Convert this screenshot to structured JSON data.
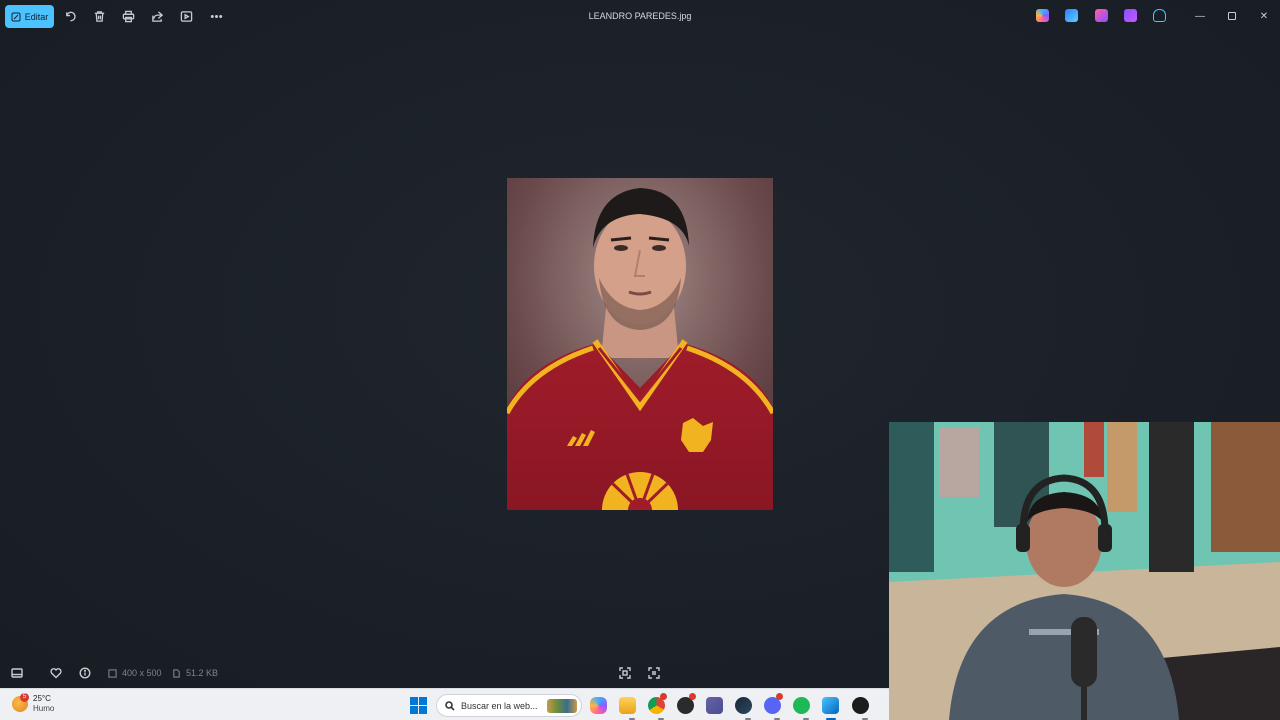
{
  "toolbar": {
    "edit_label": "Editar",
    "title": "LEANDRO PAREDES.jpg",
    "icons": [
      "rotate-icon",
      "delete-icon",
      "print-icon",
      "share-icon",
      "slideshow-icon",
      "more-icon"
    ]
  },
  "statusbar": {
    "dimensions": "400 x 500",
    "filesize": "51.2 KB"
  },
  "taskbar": {
    "weather_temp": "25°C",
    "weather_desc": "Humo",
    "weather_badge": "5",
    "search_placeholder": "Buscar en la web...",
    "accent": "#0067c0"
  },
  "colors": {
    "edit_button": "#4cc2ff",
    "app_background": "#1c2129",
    "taskbar": "#eef0f4"
  }
}
